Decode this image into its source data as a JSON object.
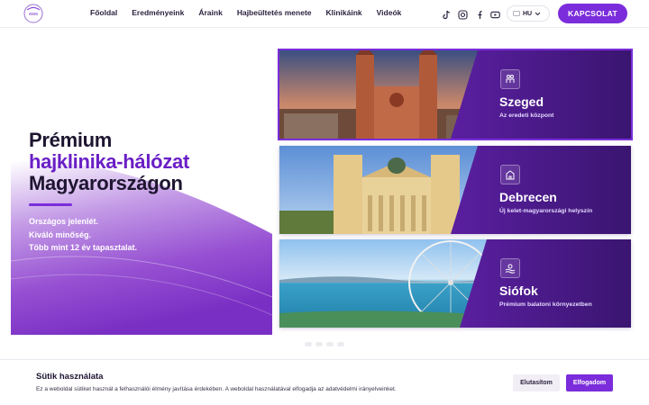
{
  "nav": {
    "items": [
      "Főoldal",
      "Eredményeink",
      "Áraink",
      "Hajbeültetés menete",
      "Klinikáink",
      "Videók"
    ]
  },
  "social": [
    "tiktok-icon",
    "instagram-icon",
    "facebook-icon",
    "youtube-icon"
  ],
  "lang": {
    "code": "HU"
  },
  "cta": {
    "label": "KAPCSOLAT"
  },
  "hero": {
    "title_line1": "Prémium",
    "title_line2": "hajklinika-hálózat",
    "title_line3": "Magyarországon",
    "lines": [
      "Országos jelenlét.",
      "Kiváló minőség.",
      "Több mint 12 év tapasztalat."
    ]
  },
  "clinics": [
    {
      "name": "Szeged",
      "subtitle": "Az eredeti központ",
      "icon": "people-icon"
    },
    {
      "name": "Debrecen",
      "subtitle": "Új kelet-magyarországi helyszín",
      "icon": "building-icon"
    },
    {
      "name": "Siófok",
      "subtitle": "Prémium balatoni környezetben",
      "icon": "waves-icon"
    }
  ],
  "cookie": {
    "title": "Sütik használata",
    "text": "Ez a weboldal sütiket használ a felhasználói élmény javítása érdekében. A weboldal használatával elfogadja az adatvédelmi irányelveinket.",
    "reject_label": "Elutasítom",
    "accept_label": "Elfogadom"
  },
  "colors": {
    "accent": "#7b2ddb",
    "deep_purple": "#3d1470",
    "text_dark": "#1e1530"
  }
}
